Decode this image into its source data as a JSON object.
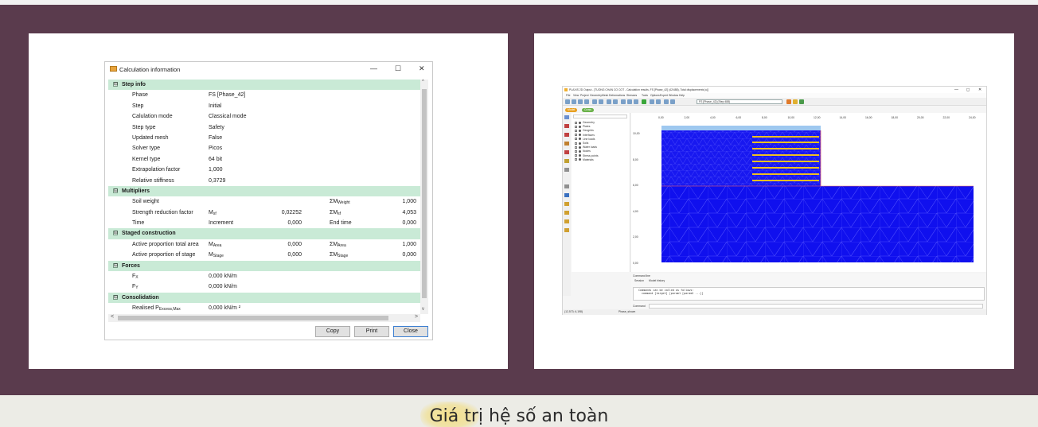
{
  "dialog": {
    "title": "Calculation information",
    "controls": {
      "minimize": "—",
      "maximize": "☐",
      "close": "✕"
    },
    "sections": [
      {
        "type": "section",
        "label": "Step info",
        "toggle": "⊟"
      },
      {
        "type": "row",
        "c1": "Phase",
        "c2": "FS [Phase_42]"
      },
      {
        "type": "row",
        "c1": "Step",
        "c2": "Initial"
      },
      {
        "type": "row",
        "c1": "Calulation mode",
        "c2": "Classical mode"
      },
      {
        "type": "row",
        "c1": "Step type",
        "c2": "Safety"
      },
      {
        "type": "row",
        "c1": "Updated mesh",
        "c2": "False"
      },
      {
        "type": "row",
        "c1": "Solver type",
        "c2": "Picos"
      },
      {
        "type": "row",
        "c1": "Kernel type",
        "c2": "64 bit"
      },
      {
        "type": "row",
        "c1": "Extrapolation factor",
        "c2": "1,000"
      },
      {
        "type": "row",
        "c1": "Relative stiffness",
        "c2": "0,3729"
      },
      {
        "type": "section",
        "label": "Multipliers",
        "toggle": "⊟"
      },
      {
        "type": "row",
        "c1": "Soil weight",
        "c2": "",
        "c3": "",
        "c4": "ΣM",
        "c4sub": "Weight",
        "c5": "1,000"
      },
      {
        "type": "row",
        "c1": "Strength reduction factor",
        "c2": "M",
        "c2sub": "sf",
        "c3": "0,02252",
        "c4": "ΣM",
        "c4sub": "sf",
        "c5": "4,053"
      },
      {
        "type": "row",
        "c1": "Time",
        "c2": "Increment",
        "c3": "0,000",
        "c4": "End time",
        "c5": "0,000"
      },
      {
        "type": "section",
        "label": "Staged construction",
        "toggle": "⊟"
      },
      {
        "type": "row",
        "c1": "Active proportion total area",
        "c2": "M",
        "c2sub": "Area",
        "c3": "0,000",
        "c4": "ΣM",
        "c4sub": "Area",
        "c5": "1,000"
      },
      {
        "type": "row",
        "c1": "Active proportion of stage",
        "c2": "M",
        "c2sub": "Stage",
        "c3": "0,000",
        "c4": "ΣM",
        "c4sub": "Stage",
        "c5": "0,000"
      },
      {
        "type": "section",
        "label": "Forces",
        "toggle": "⊟"
      },
      {
        "type": "row",
        "c1": "F",
        "c1sub": "X",
        "c2": "0,000 kN/m"
      },
      {
        "type": "row",
        "c1": "F",
        "c1sub": "Y",
        "c2": "0,000 kN/m"
      },
      {
        "type": "section",
        "label": "Consolidation",
        "toggle": "⊟"
      },
      {
        "type": "row",
        "c1": "Realised P",
        "c1sub": "Excess,Max",
        "c2": "0,000 kN/m ²"
      }
    ],
    "scroll": {
      "up": "^",
      "down": "v",
      "left": "<",
      "right": ">"
    },
    "buttons": {
      "copy": "Copy",
      "print": "Print",
      "close": "Close"
    }
  },
  "plaxis": {
    "title": "PLAXIS 2D Output - [TUONG CHAN CO COT - Calculation results, FS [Phase_42] (42/488), Total displacements |u|]",
    "window_controls": {
      "minimize": "—",
      "maximize": "◻",
      "close": "✕"
    },
    "menu": [
      "File",
      "View",
      "Project",
      "Geometry",
      "Mesh",
      "Deformations",
      "Stresses",
      "Tools",
      "Options",
      "Expert",
      "Window",
      "Help"
    ],
    "phase_select": "FS [Phase_42] (Step 488)",
    "tabs": [
      "Model",
      "Cross"
    ],
    "tree": [
      "Geometry",
      "Plates",
      "Geogrids",
      "Interfaces",
      "Line loads",
      "Soils",
      "Water loads",
      "Nodes",
      "Stress points",
      "Materials"
    ],
    "ruler_x": [
      "0,00",
      "2,00",
      "4,00",
      "6,00",
      "8,00",
      "10,00",
      "12,00",
      "14,00",
      "16,00",
      "18,00",
      "20,00",
      "22,00",
      "24,00"
    ],
    "ruler_y": [
      "10,00",
      "8,00",
      "6,00",
      "4,00",
      "2,00",
      "0,00"
    ],
    "command_label": "Command line",
    "session_tab": "Session",
    "history_tab": "Model history",
    "session_lines": [
      "Commands can be called as follows:",
      "command [target] [param1 [param2 ...]]"
    ],
    "command_prompt": "Command",
    "status_coords": "(12,573; 6,198)",
    "status_phase": "Phase_shown"
  },
  "caption": "Giá trị hệ số an toàn",
  "colors": {
    "background": "#5a3b4d",
    "section_fill": "#c9ead6",
    "soil_blue": "#1010ee",
    "plate_yellow": "#f0c020"
  }
}
